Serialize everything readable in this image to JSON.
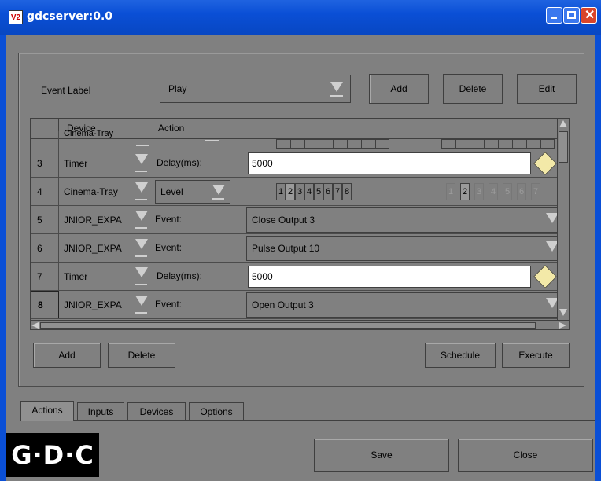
{
  "window": {
    "title": "gdcserver:0.0",
    "icon_text": "V2"
  },
  "event": {
    "label": "Event Label",
    "selected": "Play",
    "add": "Add",
    "delete": "Delete",
    "edit": "Edit"
  },
  "table": {
    "headers": {
      "device": "Device",
      "action": "Action"
    },
    "partial_row": {
      "device": "Cinema-Tray"
    },
    "rows": [
      {
        "no": "3",
        "device": "Timer",
        "action": "Delay(ms):",
        "value": "5000"
      },
      {
        "no": "4",
        "device": "Cinema-Tray",
        "action": "Level",
        "levels_a": [
          "1",
          "2",
          "3",
          "4",
          "5",
          "6",
          "7",
          "8"
        ],
        "levels_b": [
          "1",
          "2",
          "3",
          "4",
          "5",
          "6",
          "7"
        ]
      },
      {
        "no": "5",
        "device": "JNIOR_EXPA",
        "action": "Event:",
        "value": "Close Output 3"
      },
      {
        "no": "6",
        "device": "JNIOR_EXPA",
        "action": "Event:",
        "value": "Pulse Output 10"
      },
      {
        "no": "7",
        "device": "Timer",
        "action": "Delay(ms):",
        "value": "5000"
      },
      {
        "no": "8",
        "device": "JNIOR_EXPA",
        "action": "Event:",
        "value": "Open Output 3"
      }
    ]
  },
  "actions_bar": {
    "add": "Add",
    "delete": "Delete",
    "schedule": "Schedule",
    "execute": "Execute"
  },
  "tabs": [
    "Actions",
    "Inputs",
    "Devices",
    "Options"
  ],
  "footer": {
    "logo": "G·D·C",
    "save": "Save",
    "close": "Close"
  },
  "colors": {
    "titlebar": "#0a4fd6",
    "background": "#808080",
    "close_button": "#d9452a"
  }
}
